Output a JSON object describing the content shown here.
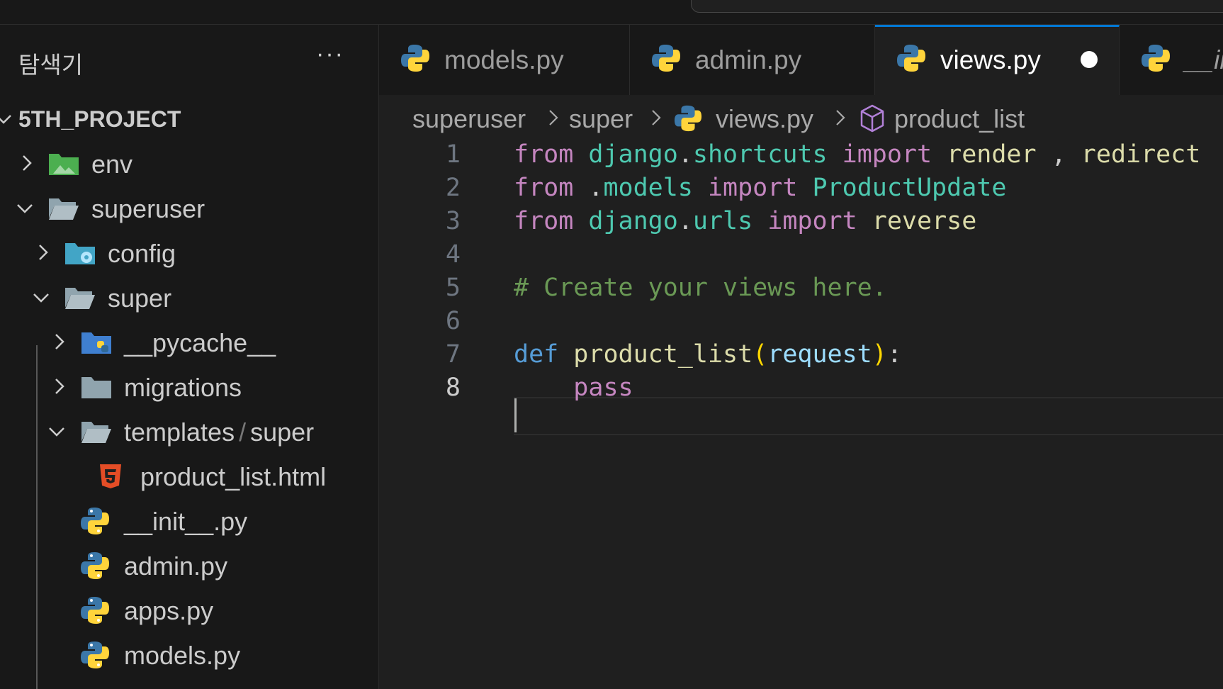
{
  "explorer": {
    "title": "탐색기",
    "more": "···",
    "project": "5TH_PROJECT",
    "items": [
      {
        "label": "env",
        "icon": "folder-env-icon"
      },
      {
        "label": "superuser",
        "icon": "folder-open-icon"
      },
      {
        "label": "config",
        "icon": "folder-config-icon"
      },
      {
        "label": "super",
        "icon": "folder-open-icon"
      },
      {
        "label": "__pycache__",
        "icon": "folder-python-icon"
      },
      {
        "label": "migrations",
        "icon": "folder-icon"
      },
      {
        "label_a": "templates",
        "label_sep": "/",
        "label_b": "super",
        "icon": "folder-open-icon"
      },
      {
        "label": "product_list.html",
        "icon": "html5-file-icon"
      },
      {
        "label": "__init__.py",
        "icon": "python-file-icon"
      },
      {
        "label": "admin.py",
        "icon": "python-file-icon"
      },
      {
        "label": "apps.py",
        "icon": "python-file-icon"
      },
      {
        "label": "models.py",
        "icon": "python-file-icon"
      }
    ]
  },
  "tabs": [
    {
      "label": "models.py",
      "active": false
    },
    {
      "label": "admin.py",
      "active": false
    },
    {
      "label": "views.py",
      "active": true,
      "modified": true
    },
    {
      "label": "__ir",
      "active": false
    }
  ],
  "breadcrumb": [
    "superuser",
    "super",
    "views.py",
    "product_list"
  ],
  "editor": {
    "current_line": 8,
    "line_numbers": [
      "1",
      "2",
      "3",
      "4",
      "5",
      "6",
      "7",
      "8"
    ],
    "lines": [
      [
        [
          "from",
          "kw"
        ],
        [
          " ",
          ""
        ],
        [
          "django",
          "mod"
        ],
        [
          ".",
          ""
        ],
        [
          "shortcuts",
          "mod"
        ],
        [
          " ",
          ""
        ],
        [
          "import",
          "kw"
        ],
        [
          " ",
          ""
        ],
        [
          "render",
          "fn"
        ],
        [
          " , ",
          ""
        ],
        [
          "redirect",
          "fn"
        ]
      ],
      [
        [
          "from",
          "kw"
        ],
        [
          " .",
          ""
        ],
        [
          "models",
          "mod"
        ],
        [
          " ",
          ""
        ],
        [
          "import",
          "kw"
        ],
        [
          " ",
          ""
        ],
        [
          "ProductUpdate",
          "cls"
        ]
      ],
      [
        [
          "from",
          "kw"
        ],
        [
          " ",
          ""
        ],
        [
          "django",
          "mod"
        ],
        [
          ".",
          ""
        ],
        [
          "urls",
          "mod"
        ],
        [
          " ",
          ""
        ],
        [
          "import",
          "kw"
        ],
        [
          " ",
          ""
        ],
        [
          "reverse",
          "fn"
        ]
      ],
      [],
      [
        [
          "# Create your views here.",
          "cm"
        ]
      ],
      [],
      [
        [
          "def",
          "def"
        ],
        [
          " ",
          ""
        ],
        [
          "product_list",
          "fn"
        ],
        [
          "(",
          "br"
        ],
        [
          "request",
          "par"
        ],
        [
          ")",
          "br"
        ],
        [
          ":",
          ""
        ]
      ],
      [
        [
          "    ",
          ""
        ],
        [
          "pass",
          "kw"
        ]
      ]
    ]
  },
  "colors": {
    "accent": "#0078d4",
    "keyword": "#c586c0",
    "module": "#4ec9b0",
    "function": "#dcdcaa",
    "comment": "#6a9955",
    "def": "#569cd6"
  }
}
